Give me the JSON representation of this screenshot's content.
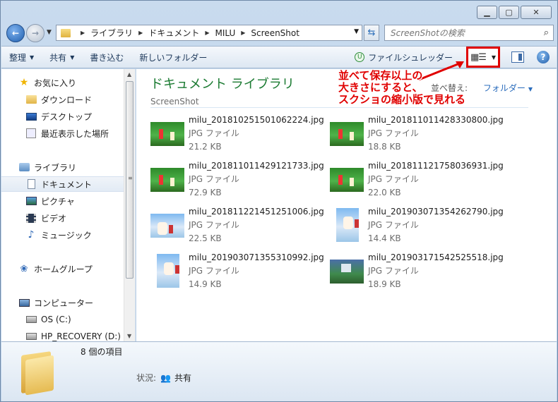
{
  "window": {
    "minimize_icon": "minimize-icon",
    "maximize_icon": "maximize-icon",
    "close_icon": "close-icon"
  },
  "address": {
    "crumbs": [
      "ライブラリ",
      "ドキュメント",
      "MILU",
      "ScreenShot"
    ],
    "search_placeholder": "ScreenShotの検索"
  },
  "toolbar": {
    "organize": "整理",
    "share": "共有",
    "burn": "書き込む",
    "new_folder": "新しいフォルダー",
    "shredder": "ファイルシュレッダー"
  },
  "nav": {
    "favorites": "お気に入り",
    "downloads": "ダウンロード",
    "desktop": "デスクトップ",
    "recent": "最近表示した場所",
    "libraries": "ライブラリ",
    "documents": "ドキュメント",
    "pictures": "ピクチャ",
    "videos": "ビデオ",
    "music": "ミュージック",
    "homegroup": "ホームグループ",
    "computer": "コンピューター",
    "drive_c": "OS (C:)",
    "drive_d": "HP_RECOVERY (D:)"
  },
  "content": {
    "library_title": "ドキュメント ライブラリ",
    "library_sub": "ScreenShot",
    "arrange_label": "並べ替え:",
    "arrange_value": "フォルダー"
  },
  "files": [
    {
      "name": "milu_201810251501062224.jpg",
      "type": "JPG ファイル",
      "size": "21.2 KB"
    },
    {
      "name": "milu_201811011428330800.jpg",
      "type": "JPG ファイル",
      "size": "18.8 KB"
    },
    {
      "name": "milu_201811011429121733.jpg",
      "type": "JPG ファイル",
      "size": "72.9 KB"
    },
    {
      "name": "milu_201811121758036931.jpg",
      "type": "JPG ファイル",
      "size": "22.0 KB"
    },
    {
      "name": "milu_201811221451251006.jpg",
      "type": "JPG ファイル",
      "size": "22.5 KB"
    },
    {
      "name": "milu_201903071354262790.jpg",
      "type": "JPG ファイル",
      "size": "14.4 KB"
    },
    {
      "name": "milu_201903071355310992.jpg",
      "type": "JPG ファイル",
      "size": "14.9 KB"
    },
    {
      "name": "milu_201903171542525518.jpg",
      "type": "JPG ファイル",
      "size": "18.9 KB"
    }
  ],
  "annotation": {
    "line1": "並べて保存以上の",
    "line2": "大きさにすると、",
    "line3": "スクショの縮小版で見れる",
    "color": "#e00000"
  },
  "details": {
    "count": "8 個の項目",
    "status_label": "状況:",
    "status_value": "共有"
  }
}
